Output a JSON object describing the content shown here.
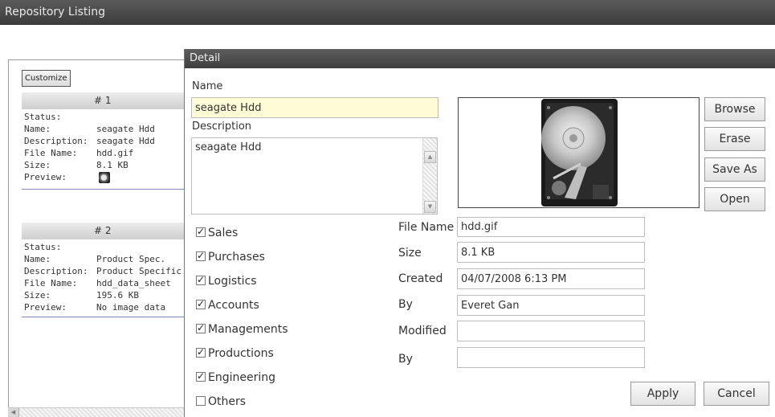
{
  "window": {
    "title": "Repository Listing"
  },
  "listing": {
    "customize_label": "Customize",
    "cards": [
      {
        "header": "# 1",
        "rows": [
          {
            "label": "Status:",
            "value": ""
          },
          {
            "label": "Name:",
            "value": "seagate Hdd"
          },
          {
            "label": "Description:",
            "value": "seagate Hdd"
          },
          {
            "label": "File Name:",
            "value": "hdd.gif"
          },
          {
            "label": "Size:",
            "value": "8.1 KB"
          },
          {
            "label": "Preview:",
            "value": ""
          }
        ]
      },
      {
        "header": "# 2",
        "rows": [
          {
            "label": "Status:",
            "value": ""
          },
          {
            "label": "Name:",
            "value": "Product Spec."
          },
          {
            "label": "Description:",
            "value": "Product Specific"
          },
          {
            "label": "File Name:",
            "value": "hdd_data_sheet"
          },
          {
            "label": "Size:",
            "value": "195.6 KB"
          },
          {
            "label": "Preview:",
            "value": "No image data"
          }
        ]
      }
    ]
  },
  "detail": {
    "title": "Detail",
    "name_label": "Name",
    "name_value": "seagate Hdd",
    "description_label": "Description",
    "description_value": "seagate Hdd",
    "buttons": {
      "browse": "Browse",
      "erase": "Erase",
      "save_as": "Save As",
      "open": "Open",
      "apply": "Apply",
      "cancel": "Cancel"
    },
    "categories": [
      {
        "label": "Sales",
        "checked": true
      },
      {
        "label": "Purchases",
        "checked": true
      },
      {
        "label": "Logistics",
        "checked": true
      },
      {
        "label": "Accounts",
        "checked": true
      },
      {
        "label": "Managements",
        "checked": true
      },
      {
        "label": "Productions",
        "checked": true
      },
      {
        "label": "Engineering",
        "checked": true
      },
      {
        "label": "Others",
        "checked": false
      }
    ],
    "info": [
      {
        "label": "File Name",
        "value": "hdd.gif"
      },
      {
        "label": "Size",
        "value": "8.1 KB"
      },
      {
        "label": "Created",
        "value": "04/07/2008 6:13 PM"
      },
      {
        "label": "By",
        "value": "Everet Gan"
      },
      {
        "label": "Modified",
        "value": ""
      },
      {
        "label": "By",
        "value": ""
      }
    ]
  },
  "icons": [
    "hard-drive-image",
    "hdd-thumbnail-icon",
    "checkbox-checked-icon",
    "checkbox-empty-icon",
    "scroll-up-icon",
    "scroll-down-icon",
    "scroll-left-icon"
  ]
}
